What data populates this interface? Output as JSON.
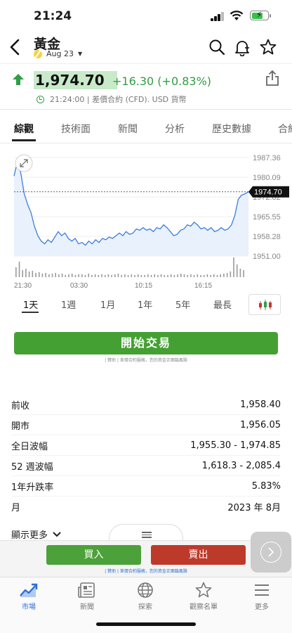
{
  "status": {
    "time": "21:24"
  },
  "header": {
    "title": "黃金",
    "contract": "Aug 23"
  },
  "quote": {
    "price": "1,974.70",
    "change": "+16.30 (+0.83%)",
    "meta": "21:24:00 | 差價合約 (CFD). USD 貨幣"
  },
  "tabs": [
    "綜觀",
    "技術面",
    "新聞",
    "分析",
    "歷史數據",
    "合約"
  ],
  "chart_data": {
    "type": "line",
    "yticks": [
      "1987.36",
      "1980.09",
      "1972.82",
      "1965.55",
      "1958.28",
      "1951.00"
    ],
    "xticks": [
      "21:30",
      "03:30",
      "10:15",
      "16:15"
    ],
    "last_price_label": "1974.70",
    "ylim": [
      1951.0,
      1987.36
    ],
    "values": [
      1980.5,
      1986.0,
      1981.5,
      1974.0,
      1970.0,
      1967.0,
      1962.0,
      1958.5,
      1956.5,
      1955.5,
      1957.0,
      1956.0,
      1958.0,
      1960.0,
      1958.5,
      1959.5,
      1957.5,
      1956.5,
      1957.5,
      1955.5,
      1956.0,
      1955.0,
      1956.5,
      1955.5,
      1957.0,
      1956.0,
      1957.5,
      1957.0,
      1958.0,
      1957.5,
      1958.5,
      1959.5,
      1958.5,
      1960.0,
      1959.0,
      1959.5,
      1961.0,
      1960.5,
      1961.5,
      1960.5,
      1961.0,
      1960.0,
      1961.5,
      1961.0,
      1962.5,
      1961.5,
      1960.0,
      1958.5,
      1959.0,
      1960.5,
      1961.0,
      1962.5,
      1962.0,
      1963.5,
      1962.5,
      1961.0,
      1961.5,
      1960.5,
      1961.5,
      1960.0,
      1960.5,
      1961.5,
      1960.5,
      1961.0,
      1962.5,
      1966.0,
      1972.0,
      1973.5,
      1974.0,
      1974.7
    ]
  },
  "range_buttons": [
    "1天",
    "1週",
    "1月",
    "1年",
    "5年",
    "最長"
  ],
  "trade_button": "開始交易",
  "trade_disclaimer": "| 贊助 | 差價合約服務，您的資金正面臨風險",
  "stats": [
    {
      "label": "前收",
      "value": "1,958.40"
    },
    {
      "label": "開市",
      "value": "1,956.05"
    },
    {
      "label": "全日波幅",
      "value": "1,955.30 - 1,974.85"
    },
    {
      "label": "52 週波幅",
      "value": "1,618.3 - 2,085.4"
    },
    {
      "label": "1年升跌率",
      "value": "5.83%"
    },
    {
      "label": "月",
      "value": "2023 年 8月"
    }
  ],
  "show_more": "顯示更多",
  "order": {
    "buy": "買入",
    "sell": "賣出",
    "note": "| 贊助 | 差價合約服務，您的資金正面臨風險"
  },
  "bottom_nav": [
    "市場",
    "新聞",
    "探索",
    "觀察名單",
    "更多"
  ],
  "colors": {
    "up": "#2f9e44",
    "buy": "#4ca13a",
    "sell": "#bd3a2b",
    "accent": "#2b6fd6",
    "line": "#3b7de0"
  }
}
